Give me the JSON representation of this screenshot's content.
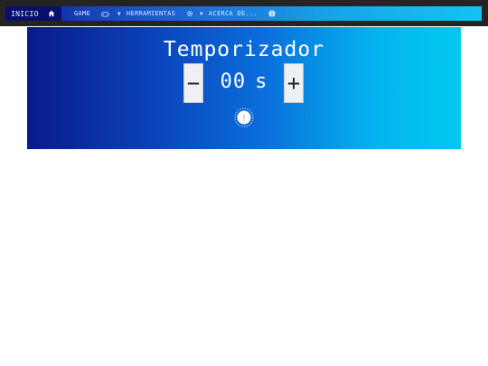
{
  "nav": {
    "home_label": "INICIO",
    "game_label": "GAME",
    "tools_label": "HERRAMIENTAS",
    "about_label": "ACERCA DE...",
    "icons": [
      "home-icon",
      "gamepad-icon",
      "gear-icon",
      "info-icon"
    ]
  },
  "timer": {
    "title": "Temporizador",
    "minus_label": "−",
    "plus_label": "+",
    "value": "00",
    "unit": "s"
  },
  "colors": {
    "topbar": "#242424",
    "nav_home_bg": "#0a0f6e",
    "gradient_start": "#0a1a8a",
    "gradient_end": "#03c8f2"
  }
}
